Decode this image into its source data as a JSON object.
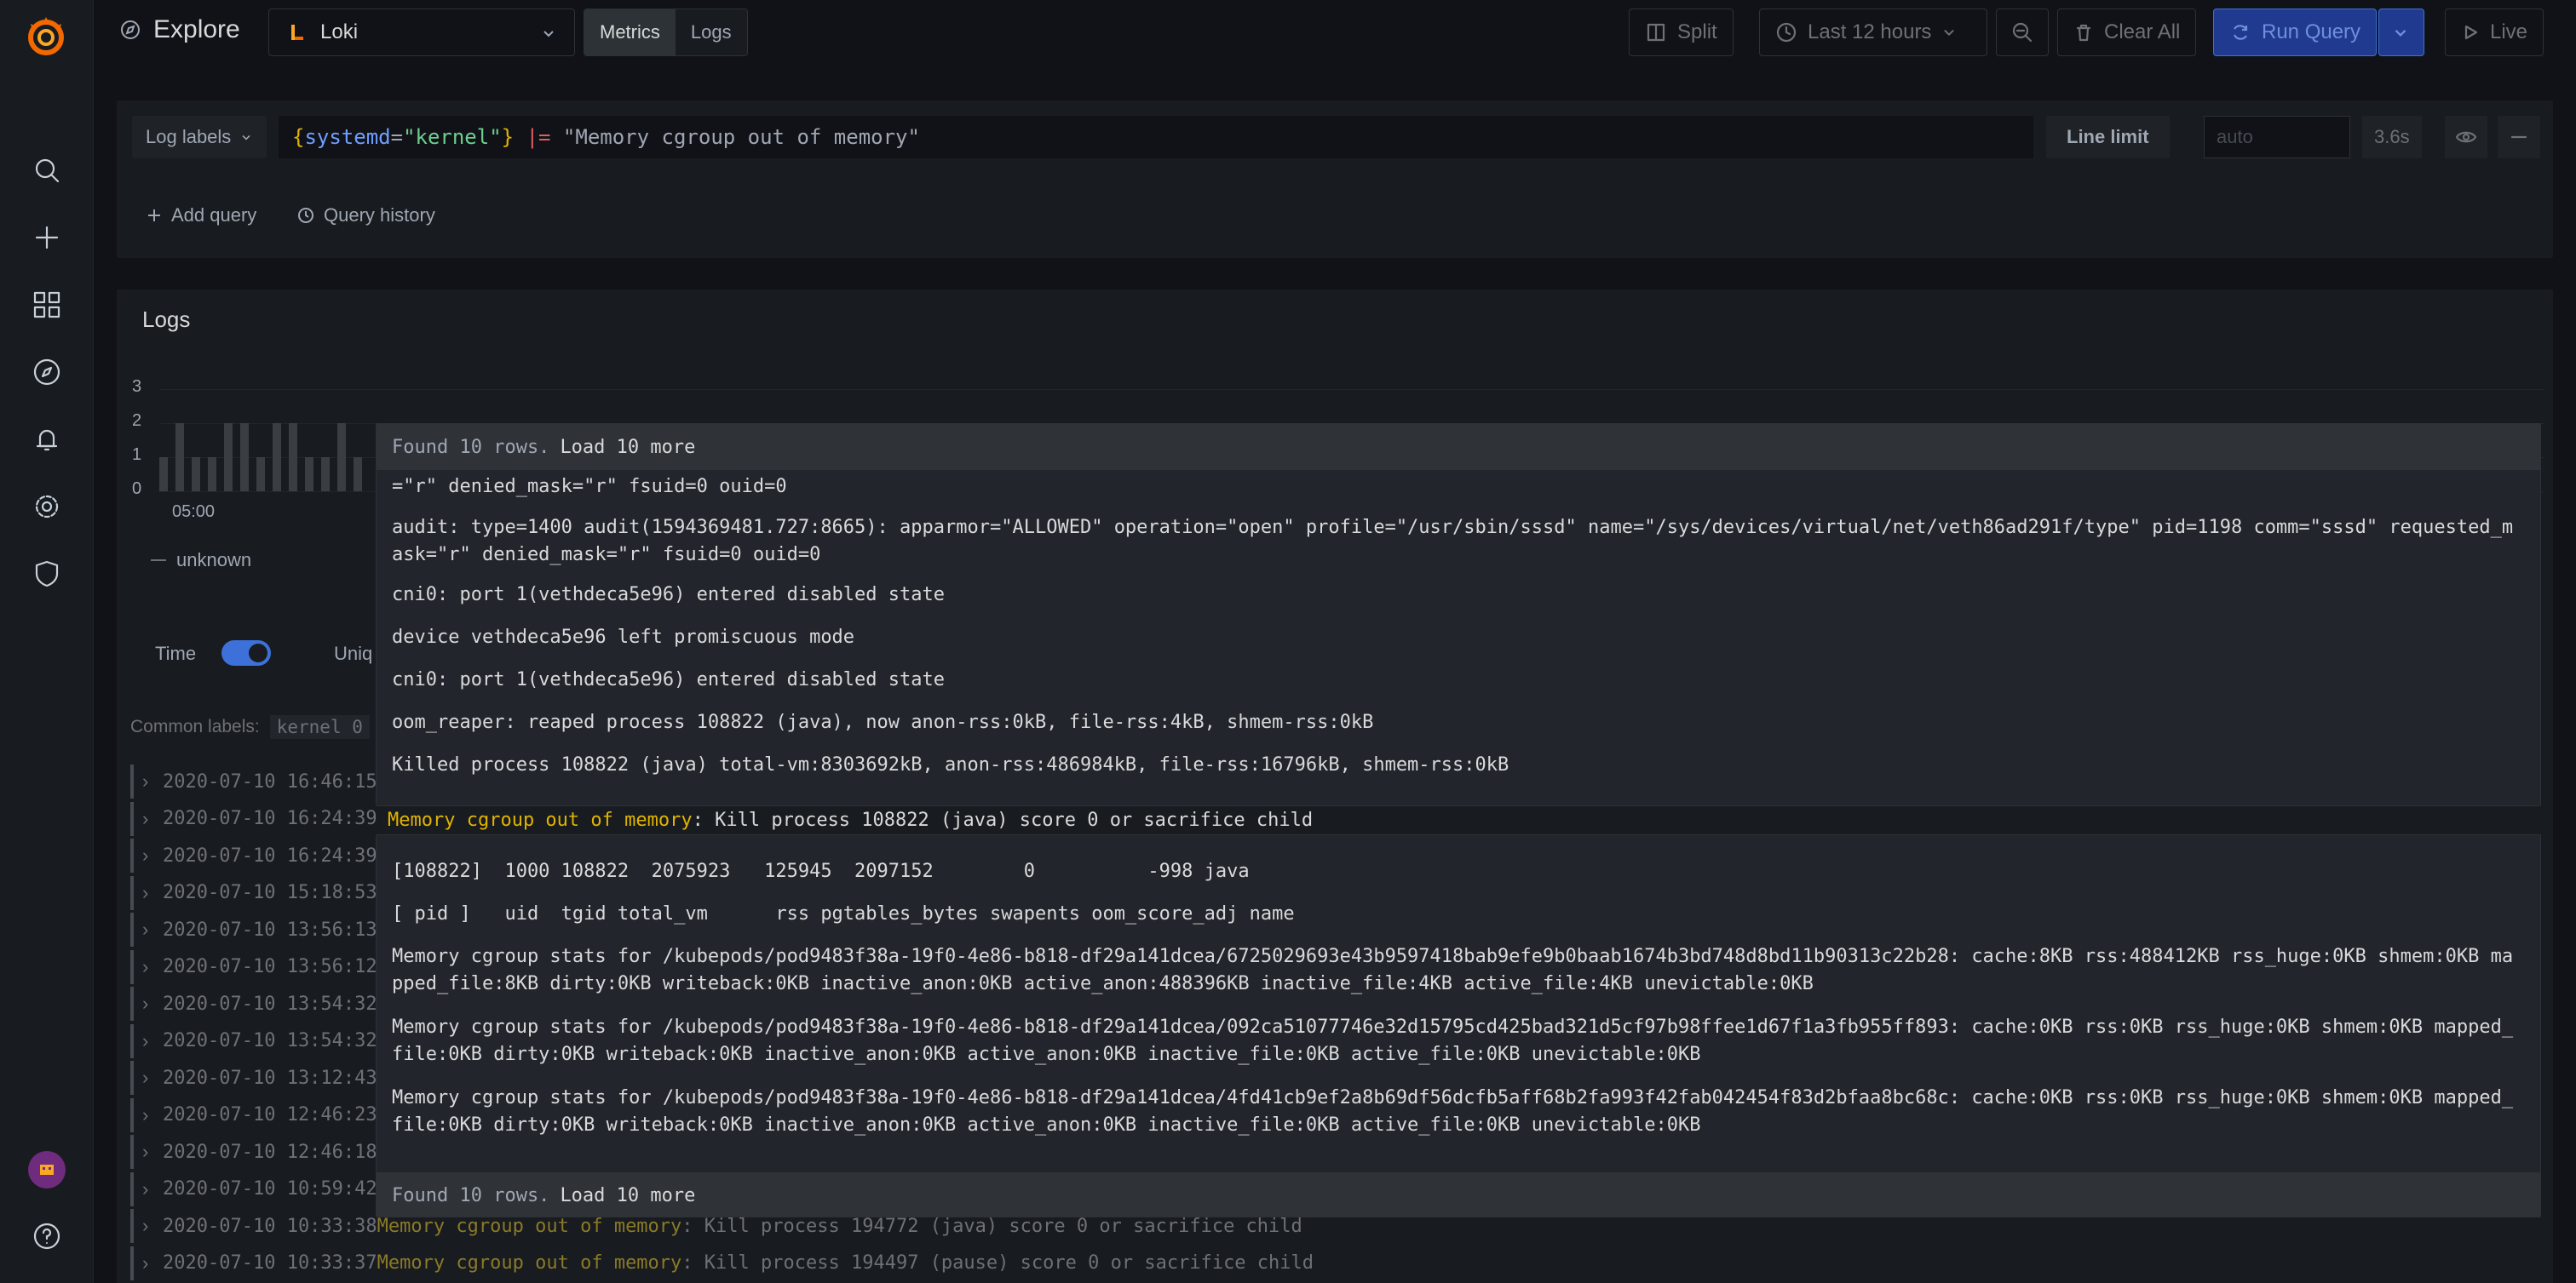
{
  "topbar": {
    "title": "Explore",
    "datasource": "Loki",
    "modes": [
      "Metrics",
      "Logs"
    ],
    "split_label": "Split",
    "time_range": "Last 12 hours",
    "clear_all_label": "Clear All",
    "run_query_label": "Run Query",
    "live_label": "Live"
  },
  "query": {
    "log_labels_label": "Log labels",
    "brace_open": "{",
    "label_key": "systemd",
    "label_eq": "=",
    "label_val": "\"kernel\"",
    "brace_close": "}",
    "pipe_op": "|=",
    "filter": "\"Memory cgroup out of memory\"",
    "line_limit_label": "Line limit",
    "line_limit_placeholder": "auto",
    "query_time": "3.6s",
    "add_query_label": "Add query",
    "query_history_label": "Query history"
  },
  "logs": {
    "title": "Logs",
    "yticks": [
      "3",
      "2",
      "1",
      "0"
    ],
    "xtick": "05:00",
    "legend_label": "unknown",
    "time_toggle_label": "Time",
    "uniq_label": "Uniq",
    "common_labels_label": "Common labels:",
    "common_label_tag": "kernel 0",
    "rows": [
      {
        "ts": "2020-07-10 16:46:15",
        "msg": ""
      },
      {
        "ts": "2020-07-10 16:24:39",
        "msg": ""
      },
      {
        "ts": "2020-07-10 16:24:39",
        "msg": ""
      },
      {
        "ts": "2020-07-10 15:18:53",
        "msg": ""
      },
      {
        "ts": "2020-07-10 13:56:13",
        "msg": ""
      },
      {
        "ts": "2020-07-10 13:56:12",
        "msg": ""
      },
      {
        "ts": "2020-07-10 13:54:32",
        "msg": ""
      },
      {
        "ts": "2020-07-10 13:54:32",
        "msg": ""
      },
      {
        "ts": "2020-07-10 13:12:43",
        "msg": ""
      },
      {
        "ts": "2020-07-10 12:46:23",
        "msg": ""
      },
      {
        "ts": "2020-07-10 12:46:18",
        "msg": ""
      },
      {
        "ts": "2020-07-10 10:59:42",
        "msg": ""
      },
      {
        "ts": "2020-07-10 10:33:38",
        "hl": "Memory cgroup out of memory",
        "msg": ": Kill process 194772 (java) score 0 or sacrifice child"
      },
      {
        "ts": "2020-07-10 10:33:37",
        "hl": "Memory cgroup out of memory",
        "msg": ": Kill process 194497 (pause) score 0 or sacrifice child"
      }
    ]
  },
  "context": {
    "found_text": "Found 10 rows.",
    "load_more": "Load 10 more",
    "top_lines": [
      "=\"r\" denied_mask=\"r\" fsuid=0 ouid=0",
      "audit: type=1400 audit(1594369481.727:8665): apparmor=\"ALLOWED\" operation=\"open\" profile=\"/usr/sbin/sssd\" name=\"/sys/devices/virtual/net/veth86ad291f/type\" pid=1198 comm=\"sssd\" requested_mask=\"r\" denied_mask=\"r\" fsuid=0 ouid=0",
      "cni0: port 1(vethdeca5e96) entered disabled state",
      "device vethdeca5e96 left promiscuous mode",
      "cni0: port 1(vethdeca5e96) entered disabled state",
      "oom_reaper: reaped process 108822 (java), now anon-rss:0kB, file-rss:4kB, shmem-rss:0kB",
      "Killed process 108822 (java) total-vm:8303692kB, anon-rss:486984kB, file-rss:16796kB, shmem-rss:0kB"
    ],
    "current_hl": "Memory cgroup out of memory",
    "current_msg": ": Kill process 108822 (java) score 0 or sacrifice child",
    "bottom_lines": [
      "[108822]  1000 108822  2075923   125945  2097152        0          -998 java",
      "[ pid ]   uid  tgid total_vm      rss pgtables_bytes swapents oom_score_adj name",
      "Memory cgroup stats for /kubepods/pod9483f38a-19f0-4e86-b818-df29a141dcea/6725029693e43b9597418bab9efe9b0baab1674b3bd748d8bd11b90313c22b28: cache:8KB rss:488412KB rss_huge:0KB shmem:0KB mapped_file:8KB dirty:0KB writeback:0KB inactive_anon:0KB active_anon:488396KB inactive_file:4KB active_file:4KB unevictable:0KB",
      "Memory cgroup stats for /kubepods/pod9483f38a-19f0-4e86-b818-df29a141dcea/092ca51077746e32d15795cd425bad321d5cf97b98ffee1d67f1a3fb955ff893: cache:0KB rss:0KB rss_huge:0KB shmem:0KB mapped_file:0KB dirty:0KB writeback:0KB inactive_anon:0KB active_anon:0KB inactive_file:0KB active_file:0KB unevictable:0KB",
      "Memory cgroup stats for /kubepods/pod9483f38a-19f0-4e86-b818-df29a141dcea/4fd41cb9ef2a8b69df56dcfb5aff68b2fa993f42fab042454f83d2bfaa8bc68c: cache:0KB rss:0KB rss_huge:0KB shmem:0KB mapped_file:0KB dirty:0KB writeback:0KB inactive_anon:0KB active_anon:0KB inactive_file:0KB active_file:0KB unevictable:0KB"
    ]
  },
  "colors": {
    "accent": "#3d71d9",
    "highlight": "#e0b400",
    "background": "#111217",
    "panel": "#181b1f"
  }
}
